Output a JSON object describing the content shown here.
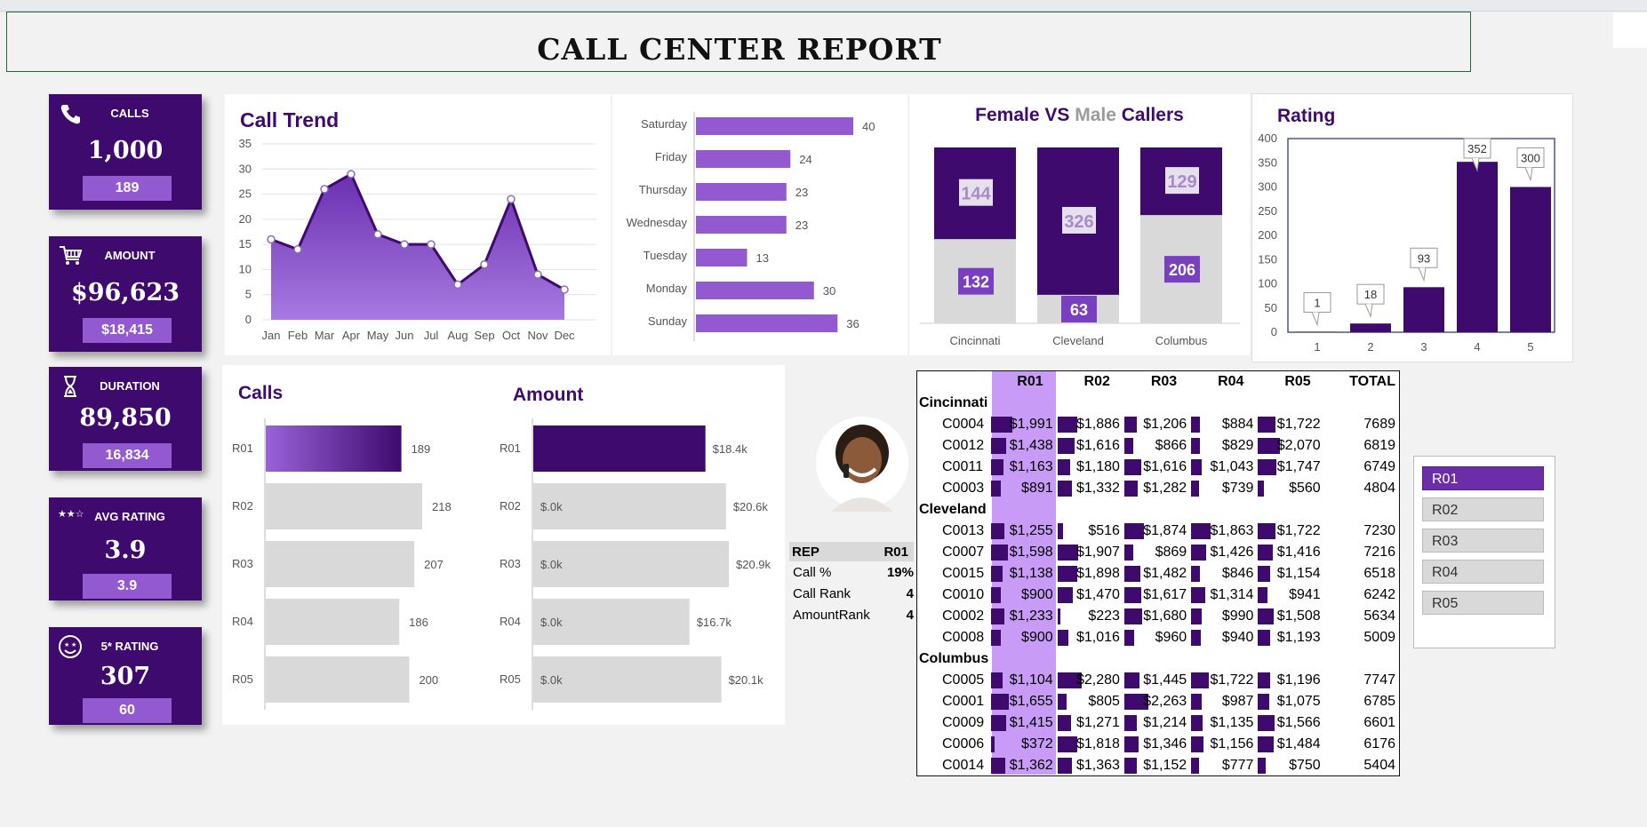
{
  "report": {
    "title": "CALL CENTER REPORT"
  },
  "kpis": [
    {
      "label": "CALLS",
      "value": "1,000",
      "sub": "189",
      "icon": "phone-icon"
    },
    {
      "label": "AMOUNT",
      "value": "$96,623",
      "sub": "$18,415",
      "icon": "cart-icon"
    },
    {
      "label": "DURATION",
      "value": "89,850",
      "sub": "16,834",
      "icon": "hourglass-icon"
    },
    {
      "label": "AVG RATING",
      "value": "3.9",
      "sub": "3.9",
      "icon": "stars-icon"
    },
    {
      "label": "5* RATING",
      "value": "307",
      "sub": "60",
      "icon": "smiley-star-eyes-icon"
    }
  ],
  "colors": {
    "brand": "#3f0a6e",
    "accent": "#9259d0",
    "light_gray": "#d9d9d9",
    "highlight_column": "#c89cf6"
  },
  "charts": {
    "call_trend_title": "Call Trend",
    "gender_title_a": "Female VS ",
    "gender_title_b": "Male",
    "gender_title_c": " Callers",
    "rating_title": "Rating",
    "calls_title": "Calls",
    "amount_title": "Amount"
  },
  "chart_data": [
    {
      "type": "area",
      "title": "Call Trend",
      "categories": [
        "Jan",
        "Feb",
        "Mar",
        "Apr",
        "May",
        "Jun",
        "Jul",
        "Aug",
        "Sep",
        "Oct",
        "Nov",
        "Dec"
      ],
      "values": [
        16,
        14,
        26,
        29,
        17,
        15,
        15,
        7,
        11,
        24,
        9,
        6
      ],
      "ylim": [
        0,
        35
      ],
      "yticks": [
        0,
        5,
        10,
        15,
        20,
        25,
        30,
        35
      ],
      "grid": true
    },
    {
      "type": "bar",
      "orientation": "horizontal",
      "categories": [
        "Saturday",
        "Friday",
        "Thursday",
        "Wednesday",
        "Tuesday",
        "Monday",
        "Sunday"
      ],
      "values": [
        40,
        24,
        23,
        23,
        13,
        30,
        36
      ]
    },
    {
      "type": "bar",
      "stacked": true,
      "title": "Female VS Male Callers",
      "categories": [
        "Cincinnati",
        "Cleveland",
        "Columbus"
      ],
      "series": [
        {
          "name": "Female",
          "values": [
            144,
            326,
            129
          ]
        },
        {
          "name": "Male",
          "values": [
            132,
            63,
            206
          ]
        }
      ]
    },
    {
      "type": "bar",
      "title": "Rating",
      "categories": [
        "1",
        "2",
        "3",
        "4",
        "5"
      ],
      "values": [
        1,
        18,
        93,
        352,
        300
      ],
      "ylim": [
        0,
        400
      ],
      "yticks": [
        0,
        50,
        100,
        150,
        200,
        250,
        300,
        350,
        400
      ]
    },
    {
      "type": "bar",
      "orientation": "horizontal",
      "title": "Calls",
      "categories": [
        "R01",
        "R02",
        "R03",
        "R04",
        "R05"
      ],
      "values": [
        189,
        218,
        207,
        186,
        200
      ],
      "highlight": "R01"
    },
    {
      "type": "bar",
      "orientation": "horizontal",
      "title": "Amount",
      "categories": [
        "R01",
        "R02",
        "R03",
        "R04",
        "R05"
      ],
      "values": [
        18400,
        20600,
        20900,
        16700,
        20100
      ],
      "data_labels": [
        "$18.4k",
        "$20.6k",
        "$20.9k",
        "$16.7k",
        "$20.1k"
      ],
      "inner_labels": [
        "",
        "$.0k",
        "$.0k",
        "$.0k",
        "$.0k"
      ],
      "highlight": "R01"
    }
  ],
  "rep": {
    "header_label": "REP",
    "header_value": "R01",
    "rows": [
      {
        "label": "Call %",
        "value": "19%"
      },
      {
        "label": "Call Rank",
        "value": "4"
      },
      {
        "label": "AmountRank",
        "value": "4"
      }
    ]
  },
  "table": {
    "columns": [
      "R01",
      "R02",
      "R03",
      "R04",
      "R05",
      "TOTAL"
    ],
    "groups": [
      {
        "name": "Cincinnati",
        "rows": [
          {
            "id": "C0004",
            "cells": [
              1991,
              1886,
              1206,
              884,
              1722
            ],
            "total": "7689"
          },
          {
            "id": "C0012",
            "cells": [
              1438,
              1616,
              866,
              829,
              2070
            ],
            "total": "6819"
          },
          {
            "id": "C0011",
            "cells": [
              1163,
              1180,
              1616,
              1043,
              1747
            ],
            "total": "6749"
          },
          {
            "id": "C0003",
            "cells": [
              891,
              1332,
              1282,
              739,
              560
            ],
            "total": "4804"
          }
        ]
      },
      {
        "name": "Cleveland",
        "rows": [
          {
            "id": "C0013",
            "cells": [
              1255,
              516,
              1874,
              1863,
              1722
            ],
            "total": "7230"
          },
          {
            "id": "C0007",
            "cells": [
              1598,
              1907,
              869,
              1426,
              1416
            ],
            "total": "7216"
          },
          {
            "id": "C0015",
            "cells": [
              1138,
              1898,
              1482,
              846,
              1154
            ],
            "total": "6518"
          },
          {
            "id": "C0010",
            "cells": [
              900,
              1470,
              1617,
              1314,
              941
            ],
            "total": "6242"
          },
          {
            "id": "C0002",
            "cells": [
              1233,
              223,
              1680,
              990,
              1508
            ],
            "total": "5634"
          },
          {
            "id": "C0008",
            "cells": [
              900,
              1016,
              960,
              940,
              1193
            ],
            "total": "5009"
          }
        ]
      },
      {
        "name": "Columbus",
        "rows": [
          {
            "id": "C0005",
            "cells": [
              1104,
              2280,
              1445,
              1722,
              1196
            ],
            "total": "7747"
          },
          {
            "id": "C0001",
            "cells": [
              1655,
              805,
              2263,
              987,
              1075
            ],
            "total": "6785"
          },
          {
            "id": "C0009",
            "cells": [
              1415,
              1271,
              1214,
              1135,
              1566
            ],
            "total": "6601"
          },
          {
            "id": "C0006",
            "cells": [
              372,
              1818,
              1346,
              1156,
              1484
            ],
            "total": "6176"
          },
          {
            "id": "C0014",
            "cells": [
              1362,
              1363,
              1152,
              777,
              750
            ],
            "total": "5404"
          }
        ]
      }
    ]
  },
  "slicer": {
    "items": [
      "R01",
      "R02",
      "R03",
      "R04",
      "R05"
    ],
    "selected": "R01"
  }
}
